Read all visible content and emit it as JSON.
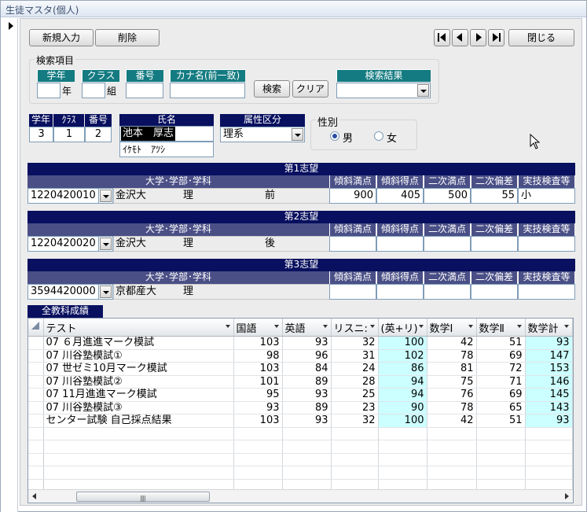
{
  "window": {
    "title": "生徒マスタ(個人)"
  },
  "toolbar": {
    "new_label": "新規入力",
    "delete_label": "削除",
    "close_label": "閉じる"
  },
  "search": {
    "legend": "検索項目",
    "grade_header": "学年",
    "grade_value": "",
    "grade_unit": "年",
    "class_header": "クラス",
    "class_value": "",
    "class_unit": "組",
    "number_header": "番号",
    "number_value": "",
    "kana_header": "カナ名(前一致)",
    "kana_value": "",
    "search_button": "検索",
    "clear_button": "クリア",
    "results_header": "検索結果",
    "results_value": ""
  },
  "student": {
    "grade_header": "学年",
    "class_header": "ｸﾗｽ",
    "number_header": "番号",
    "grade": "3",
    "class": "1",
    "number": "2",
    "name_header": "氏名",
    "name": "池本　厚志",
    "kana": "ｲｹﾓﾄ　ｱﾂｼ",
    "attr_header": "属性区分",
    "attr": "理系",
    "gender_legend": "性別",
    "gender_male": "男",
    "gender_female": "女",
    "gender_selected": "男"
  },
  "choice_columns": {
    "school": "大学･学部･学科",
    "max": "傾斜満点",
    "score": "傾斜得点",
    "second_max": "二次満点",
    "second_dev": "二次偏差",
    "practical": "実技検査等"
  },
  "choices": [
    {
      "title": "第1志望",
      "code": "1220420010",
      "univ": "金沢大",
      "faculty": "理",
      "term": "前",
      "max": "900",
      "score": "405",
      "second_max": "500",
      "second_dev": "55",
      "practical": "小"
    },
    {
      "title": "第2志望",
      "code": "1220420020",
      "univ": "金沢大",
      "faculty": "理",
      "term": "後",
      "max": "",
      "score": "",
      "second_max": "",
      "second_dev": "",
      "practical": ""
    },
    {
      "title": "第3志望",
      "code": "3594420000",
      "univ": "京都産大",
      "faculty": "理",
      "term": "",
      "max": "",
      "score": "",
      "second_max": "",
      "second_dev": "",
      "practical": ""
    }
  ],
  "grades": {
    "tab_label": "全教科成績",
    "columns": [
      "テスト",
      "国語",
      "英語",
      "リスニ:",
      "(英+リ)",
      "数学Ⅰ",
      "数学Ⅱ",
      "数学計"
    ],
    "rows": [
      [
        "07 ６月進進マーク模試",
        "103",
        "93",
        "32",
        "100",
        "42",
        "51",
        "93"
      ],
      [
        "07 川谷塾模試①",
        "98",
        "96",
        "31",
        "102",
        "78",
        "69",
        "147"
      ],
      [
        "07 世ゼミ10月マーク模試",
        "103",
        "84",
        "24",
        "86",
        "81",
        "72",
        "153"
      ],
      [
        "07 川谷塾模試②",
        "101",
        "89",
        "28",
        "94",
        "75",
        "71",
        "146"
      ],
      [
        "07 11月進進マーク模試",
        "95",
        "93",
        "25",
        "94",
        "76",
        "69",
        "145"
      ],
      [
        "07 川谷塾模試③",
        "93",
        "89",
        "23",
        "90",
        "78",
        "65",
        "143"
      ],
      [
        "センター試験 自己採点結果",
        "103",
        "93",
        "32",
        "100",
        "42",
        "51",
        "93"
      ]
    ],
    "empty_rows": 6
  },
  "icons": [
    "record-selector-arrow-icon",
    "first-record-icon",
    "prev-record-icon",
    "next-record-icon",
    "last-record-icon",
    "mouse-cursor-icon"
  ],
  "colors": {
    "teal_header": "#137b81",
    "navy_header": "#08105f",
    "subheader": "#4a4f86",
    "highlight_cell": "#ccffff"
  }
}
